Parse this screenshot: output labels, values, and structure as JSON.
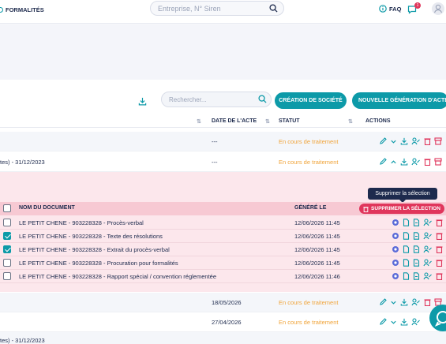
{
  "header": {
    "brand": "FORMALITÉS",
    "search_placeholder": "Entreprise, N° Siren",
    "faq_label": "FAQ",
    "notifications_count": "1"
  },
  "toolbar": {
    "search_placeholder": "Rechercher...",
    "create_button": "CRÉATION DE SOCIÉTÉ",
    "newgen_button": "NOUVELLE GÉNÉRATION D'ACTES"
  },
  "table": {
    "headers": {
      "date": "DATE DE L'ACTE",
      "status": "STATUT",
      "actions": "ACTIONS"
    },
    "rows": [
      {
        "label": "",
        "date": "---",
        "status": "En cours de traitement"
      },
      {
        "label": "tes) - 31/12/2023",
        "date": "---",
        "status": "En cours de traitement"
      },
      {
        "label": "",
        "date": "18/05/2026",
        "status": "En cours de traitement"
      },
      {
        "label": "",
        "date": "27/04/2026",
        "status": "En cours de traitement"
      },
      {
        "label": "tes) - 31/12/2023",
        "date": "",
        "status": ""
      }
    ]
  },
  "documents": {
    "headers": {
      "name": "NOM DU DOCUMENT",
      "generated": "GÉNÉRÉ LE"
    },
    "tooltip": "Supprimer la sélection",
    "delete_button": "SUPPRIMER LA SÉLECTION",
    "items": [
      {
        "name": "LE PETIT CHENE - 903228328 - Procès-verbal",
        "generated": "12/06/2026 11:45",
        "checked": false
      },
      {
        "name": "LE PETIT CHENE - 903228328 - Texte des résolutions",
        "generated": "12/06/2026 11:45",
        "checked": true
      },
      {
        "name": "LE PETIT CHENE - 903228328 - Extrait du procès-verbal",
        "generated": "12/06/2026 11:45",
        "checked": true
      },
      {
        "name": "LE PETIT CHENE - 903228328 - Procuration pour formalités",
        "generated": "12/06/2026 11:45",
        "checked": false
      },
      {
        "name": "LE PETIT CHENE - 903228328 - Rapport spécial / convention réglementée",
        "generated": "12/06/2026 11:46",
        "checked": false
      }
    ]
  },
  "colors": {
    "accent": "#0d9aa8",
    "danger": "#e0365c",
    "status": "#f0a43a",
    "selection_bg": "#fce7ec"
  },
  "icons": [
    "search-icon",
    "help-icon",
    "chat-icon",
    "user-icon",
    "download-icon",
    "edit-icon",
    "chevron-down-icon",
    "chevron-up-icon",
    "sign-icon",
    "delete-icon",
    "archive-icon",
    "view-icon",
    "document-icon"
  ]
}
